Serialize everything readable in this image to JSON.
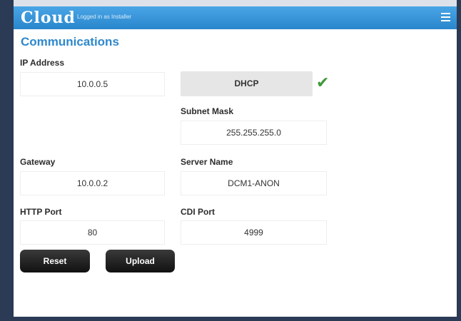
{
  "app": {
    "brand": "Cloud",
    "logged_in_text": "Logged in as Installer"
  },
  "page": {
    "title": "Communications"
  },
  "form": {
    "ip_address": {
      "label": "IP Address",
      "value": "10.0.0.5"
    },
    "dhcp": {
      "label": "DHCP",
      "status": "enabled",
      "status_icon": "check-icon"
    },
    "subnet_mask": {
      "label": "Subnet Mask",
      "value": "255.255.255.0"
    },
    "gateway": {
      "label": "Gateway",
      "value": "10.0.0.2"
    },
    "server_name": {
      "label": "Server Name",
      "value": "DCM1-ANON"
    },
    "http_port": {
      "label": "HTTP Port",
      "value": "80"
    },
    "cdi_port": {
      "label": "CDI Port",
      "value": "4999"
    }
  },
  "actions": {
    "reset_label": "Reset",
    "upload_label": "Upload"
  },
  "colors": {
    "header": "#2a86cc",
    "heading": "#2e88cc",
    "check": "#3f9a3a",
    "button": "#1a1a1a"
  }
}
